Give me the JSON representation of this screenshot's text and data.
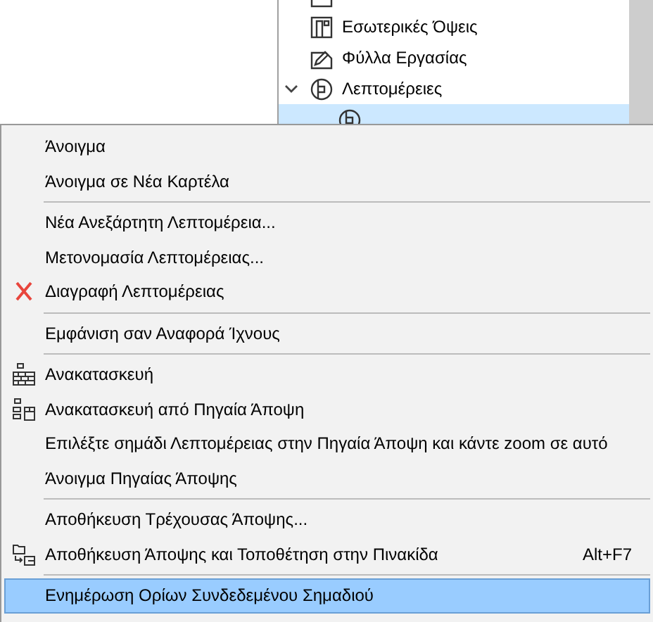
{
  "tree": {
    "items": [
      {
        "kind": "view"
      },
      {
        "kind": "interior",
        "label": "Εσωτερικές Όψεις",
        "selected": false
      },
      {
        "kind": "worksheet",
        "label": "Φύλλα Εργασίας",
        "selected": false
      },
      {
        "kind": "detail",
        "label": "Λεπτομέρειες",
        "expanded": true,
        "selected": false,
        "children": [
          {
            "kind": "detail",
            "selected": true
          }
        ]
      }
    ]
  },
  "menu": {
    "items": [
      {
        "kind": "item",
        "label": "Άνοιγμα",
        "selected": false
      },
      {
        "kind": "item",
        "label": "Άνοιγμα σε Νέα Καρτέλα",
        "selected": false
      },
      {
        "kind": "separator"
      },
      {
        "kind": "item",
        "label": "Νέα Ανεξάρτητη Λεπτομέρεια...",
        "selected": false
      },
      {
        "kind": "item",
        "label": "Μετονομασία Λεπτομέρειας...",
        "selected": false
      },
      {
        "kind": "delete",
        "label": "Διαγραφή Λεπτομέρειας",
        "selected": false
      },
      {
        "kind": "separator"
      },
      {
        "kind": "item",
        "label": "Εμφάνιση σαν Αναφορά Ίχνους",
        "selected": false
      },
      {
        "kind": "separator"
      },
      {
        "kind": "rebuild",
        "label": "Ανακατασκευή",
        "selected": false
      },
      {
        "kind": "source",
        "label": "Ανακατασκευή από Πηγαία Άποψη",
        "selected": false
      },
      {
        "kind": "item",
        "label": "Επιλέξτε σημάδι Λεπτομέρειας στην Πηγαία Άποψη και κάντε zoom σε αυτό",
        "selected": false
      },
      {
        "kind": "item",
        "label": "Άνοιγμα Πηγαίας Άποψης",
        "selected": false
      },
      {
        "kind": "separator"
      },
      {
        "kind": "item",
        "label": "Αποθήκευση Τρέχουσας Άποψης...",
        "selected": false
      },
      {
        "kind": "place",
        "label": "Αποθήκευση Άποψης και Τοποθέτηση στην Πινακίδα",
        "shortcut": "Alt+F7",
        "selected": false
      },
      {
        "kind": "separator"
      },
      {
        "kind": "item",
        "label": "Ενημέρωση Ορίων Συνδεδεμένου Σημαδιού",
        "selected": true
      }
    ]
  }
}
